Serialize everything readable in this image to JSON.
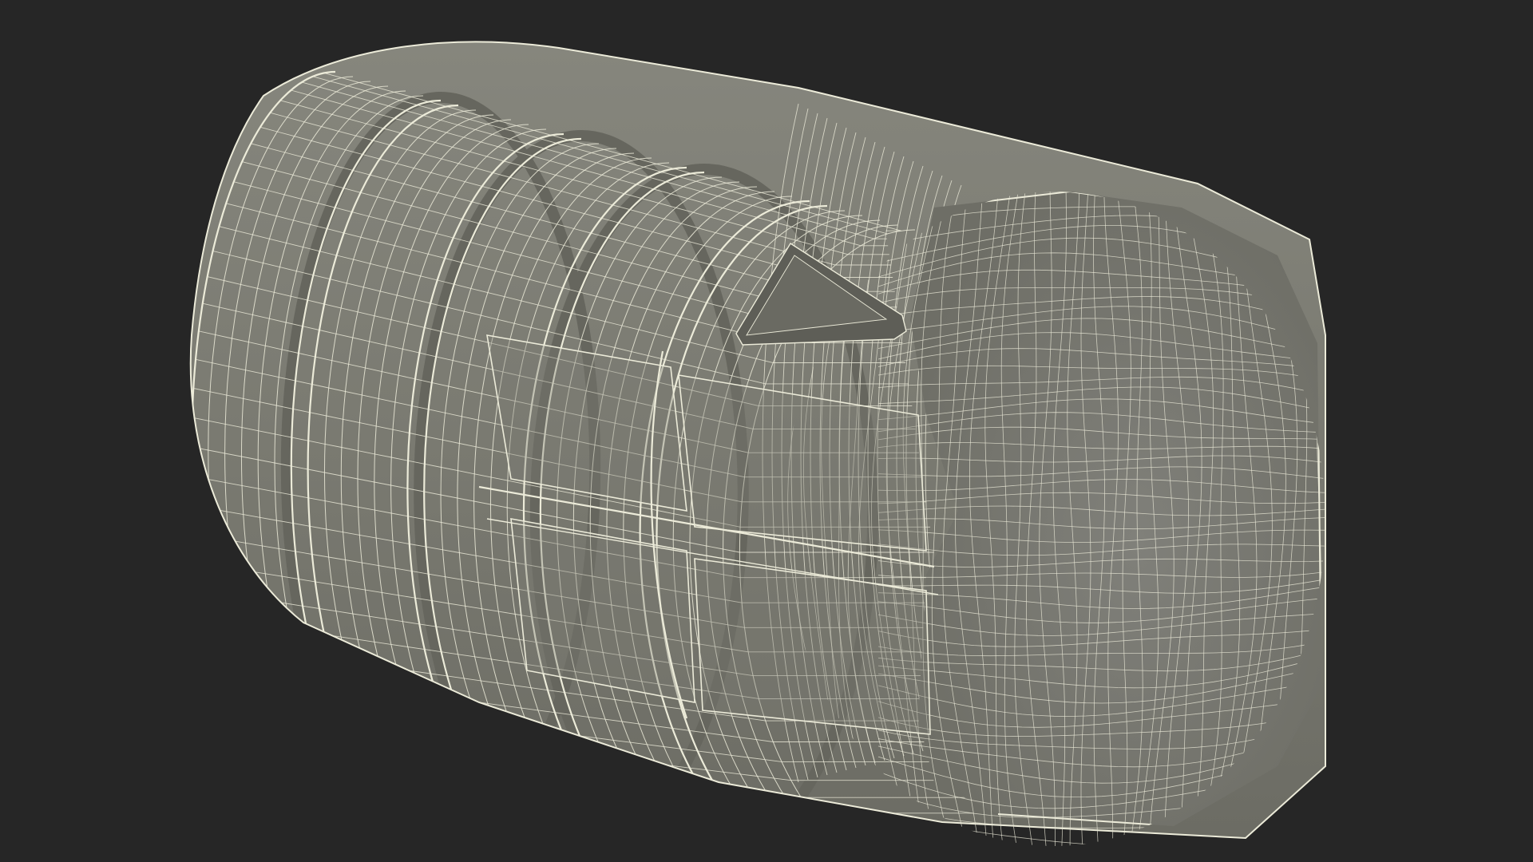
{
  "scene": {
    "subject": "wireframe-3d-model",
    "colors": {
      "background": "#262626",
      "surface": "#7b7b72",
      "surface_dark": "#66665e",
      "surface_light": "#8c8c83",
      "wire": "#ecebd9"
    }
  }
}
